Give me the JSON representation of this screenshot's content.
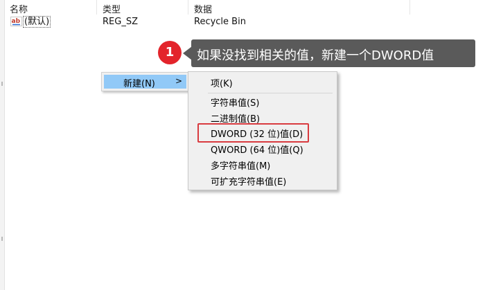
{
  "columns": {
    "name": "名称",
    "type": "类型",
    "data": "数据"
  },
  "rows": [
    {
      "icon": "string-value-icon",
      "name": "(默认)",
      "type": "REG_SZ",
      "data": "Recycle Bin"
    }
  ],
  "callout": {
    "step": "1",
    "text": "如果没找到相关的值，新建一个DWORD值"
  },
  "context_menu": {
    "new_label": "新建(N)",
    "arrow": ">"
  },
  "submenu": {
    "items": [
      {
        "label": "项(K)"
      },
      {
        "label": "字符串值(S)"
      },
      {
        "label": "二进制值(B)"
      },
      {
        "label": "DWORD (32 位)值(D)"
      },
      {
        "label": "QWORD (64 位)值(Q)"
      },
      {
        "label": "多字符串值(M)"
      },
      {
        "label": "可扩充字符串值(E)"
      }
    ]
  },
  "colors": {
    "menu_highlight": "#91c9f7",
    "callout_bg": "#5a5a5a",
    "badge": "#e3242b",
    "emphasis_border": "#d93a3f"
  }
}
